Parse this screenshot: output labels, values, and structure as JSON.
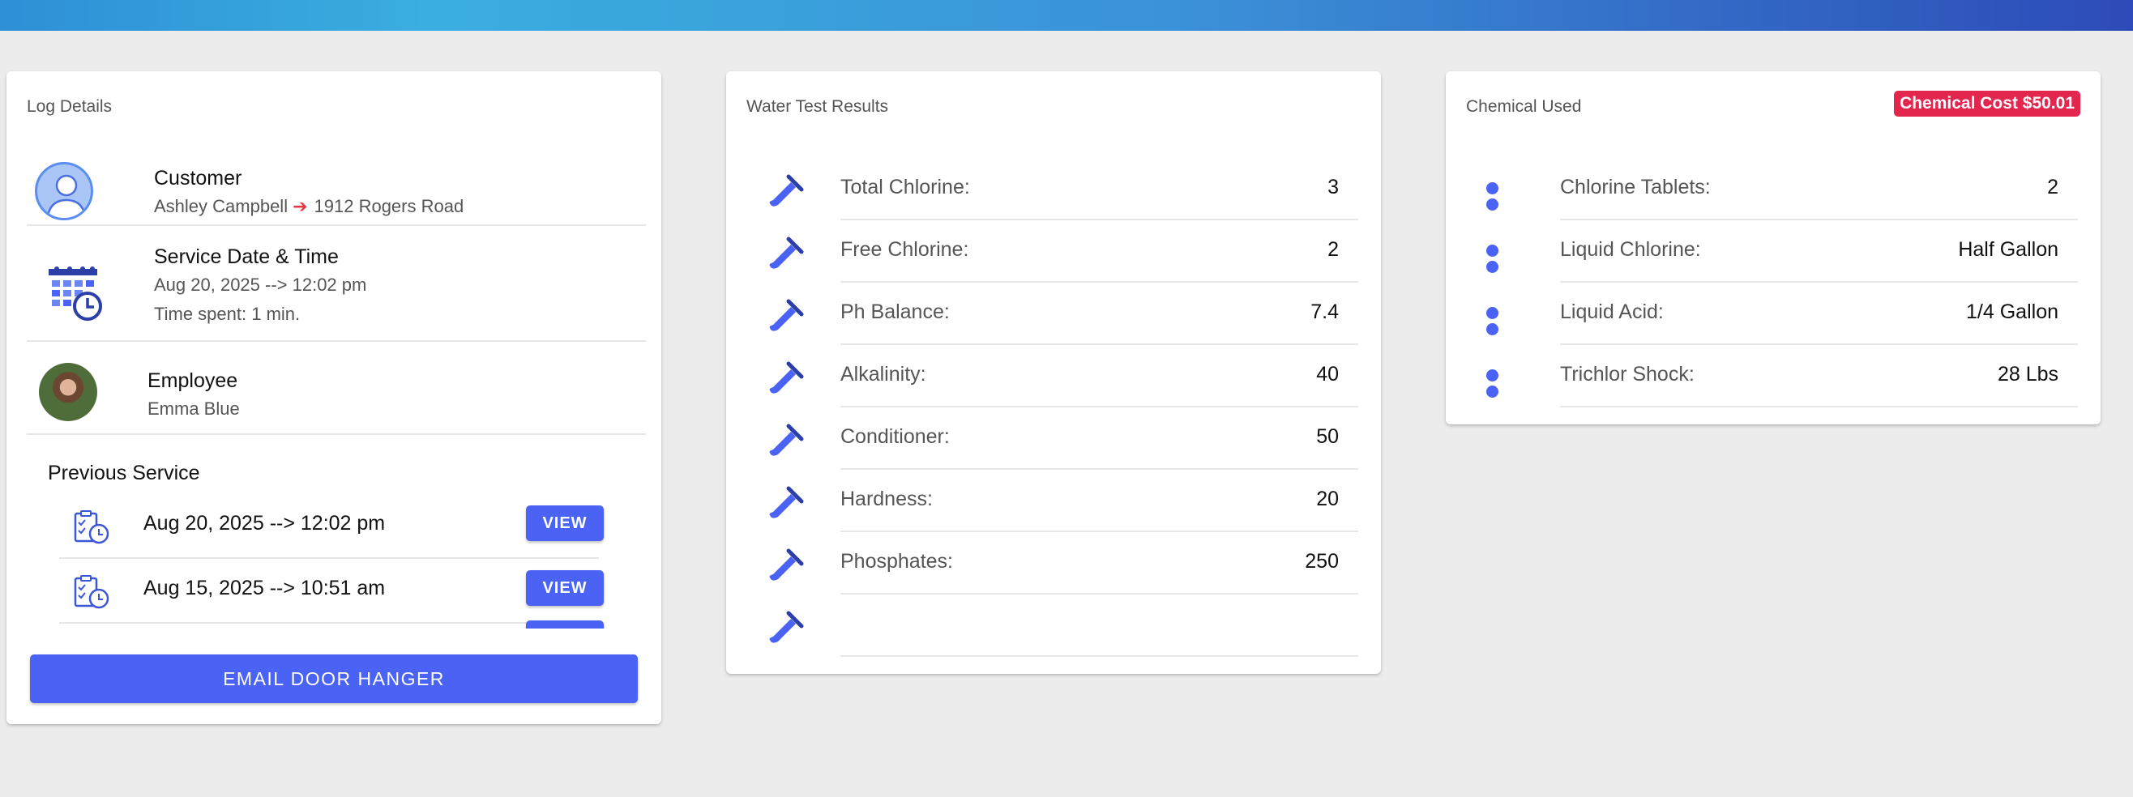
{
  "colors": {
    "accent": "#4a63f5",
    "badge": "#e3264e",
    "arrow": "#e53945"
  },
  "log": {
    "title": "Log Details",
    "customer": {
      "heading": "Customer",
      "name": "Ashley Campbell",
      "address": "1912 Rogers Road"
    },
    "service": {
      "heading": "Service Date & Time",
      "datetime": "Aug 20, 2025 --> 12:02 pm",
      "time_spent": "Time spent: 1 min."
    },
    "employee": {
      "heading": "Employee",
      "name": "Emma Blue"
    },
    "previous": {
      "heading": "Previous Service",
      "items": [
        {
          "date": "Aug 20, 2025 --> 12:02 pm",
          "button": "VIEW"
        },
        {
          "date": "Aug 15, 2025 --> 10:51 am",
          "button": "VIEW"
        },
        {
          "date": "",
          "button": ""
        }
      ]
    },
    "email_button": "EMAIL DOOR HANGER"
  },
  "water": {
    "title": "Water Test Results",
    "rows": [
      {
        "label": "Total Chlorine:",
        "value": "3"
      },
      {
        "label": "Free Chlorine:",
        "value": "2"
      },
      {
        "label": "Ph Balance:",
        "value": "7.4"
      },
      {
        "label": "Alkalinity:",
        "value": "40"
      },
      {
        "label": "Conditioner:",
        "value": "50"
      },
      {
        "label": "Hardness:",
        "value": "20"
      },
      {
        "label": "Phosphates:",
        "value": "250"
      },
      {
        "label": "",
        "value": ""
      }
    ]
  },
  "chemical": {
    "title": "Chemical Used",
    "cost_badge": "Chemical Cost $50.01",
    "rows": [
      {
        "label": "Chlorine Tablets:",
        "value": "2"
      },
      {
        "label": "Liquid Chlorine:",
        "value": "Half Gallon"
      },
      {
        "label": "Liquid Acid:",
        "value": "1/4 Gallon"
      },
      {
        "label": "Trichlor Shock:",
        "value": "28 Lbs"
      }
    ]
  }
}
